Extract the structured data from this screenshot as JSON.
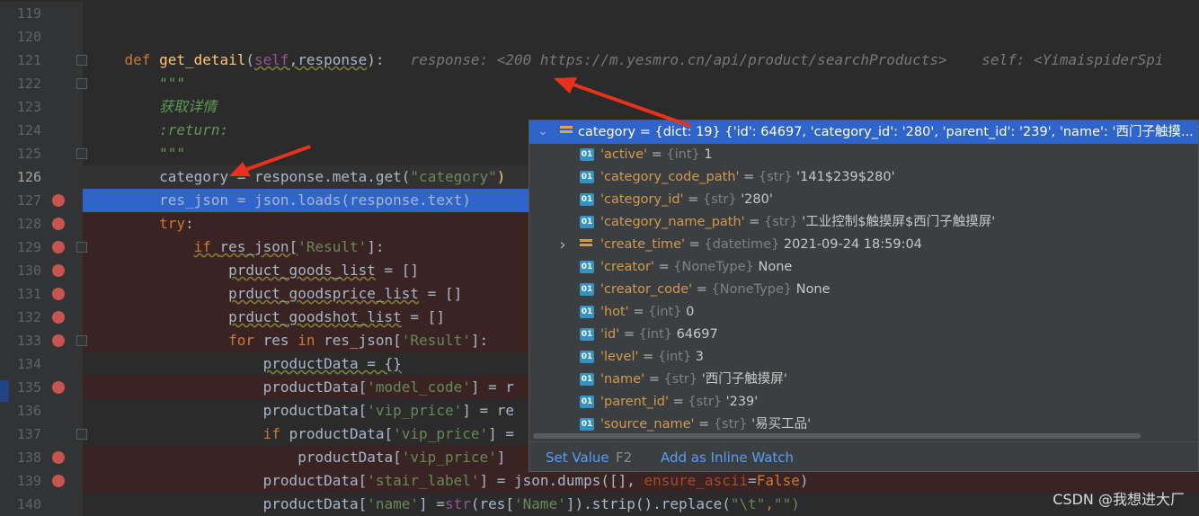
{
  "editor": {
    "lines": [
      {
        "num": "119",
        "segs": []
      },
      {
        "num": "120",
        "segs": []
      },
      {
        "num": "121",
        "fold": true,
        "segs": [
          {
            "t": "    ",
            "c": ""
          },
          {
            "t": "def ",
            "c": "kw"
          },
          {
            "t": "get_detail",
            "c": "fn"
          },
          {
            "t": "(",
            "c": ""
          },
          {
            "t": "self",
            "c": "self sq"
          },
          {
            "t": ",",
            "c": "sq"
          },
          {
            "t": "response",
            "c": "sq"
          },
          {
            "t": "):   ",
            "c": ""
          },
          {
            "t": "response: <200 https://m.yesmro.cn/api/product/searchProducts>    self: <YimaispiderSpi",
            "c": "hint"
          }
        ]
      },
      {
        "num": "122",
        "fold": true,
        "segs": [
          {
            "t": "        ",
            "c": ""
          },
          {
            "t": "\"\"\"",
            "c": "doc"
          }
        ]
      },
      {
        "num": "123",
        "segs": [
          {
            "t": "        ",
            "c": ""
          },
          {
            "t": "获取详情",
            "c": "doc"
          }
        ]
      },
      {
        "num": "124",
        "segs": [
          {
            "t": "        ",
            "c": ""
          },
          {
            "t": ":return:",
            "c": "doc"
          }
        ]
      },
      {
        "num": "125",
        "fold": true,
        "segs": [
          {
            "t": "        ",
            "c": ""
          },
          {
            "t": "\"\"\"",
            "c": "doc"
          }
        ]
      },
      {
        "num": "126",
        "current": true,
        "segs": [
          {
            "t": "        category = response.meta.get(",
            "c": ""
          },
          {
            "t": "\"category\"",
            "c": "str"
          },
          {
            "t": ")",
            "c": "fn"
          }
        ]
      },
      {
        "num": "127",
        "bp": true,
        "selected": true,
        "segs": [
          {
            "t": "        res_json = json.loads(response.text)",
            "c": ""
          }
        ]
      },
      {
        "num": "128",
        "bp": true,
        "segs": [
          {
            "t": "        ",
            "c": ""
          },
          {
            "t": "try",
            "c": "kw"
          },
          {
            "t": ":",
            "c": ""
          }
        ]
      },
      {
        "num": "129",
        "bp": true,
        "fold": true,
        "segs": [
          {
            "t": "            ",
            "c": ""
          },
          {
            "t": "if ",
            "c": "kw sq"
          },
          {
            "t": "res_json[",
            "c": "sq"
          },
          {
            "t": "'Result'",
            "c": "str"
          },
          {
            "t": "]:",
            "c": ""
          }
        ]
      },
      {
        "num": "130",
        "bp": true,
        "segs": [
          {
            "t": "                ",
            "c": ""
          },
          {
            "t": "prduct_goods_list",
            "c": "sq"
          },
          {
            "t": " = []",
            "c": ""
          }
        ]
      },
      {
        "num": "131",
        "bp": true,
        "segs": [
          {
            "t": "                ",
            "c": ""
          },
          {
            "t": "prduct_goodsprice_list",
            "c": "sq"
          },
          {
            "t": " = []",
            "c": ""
          }
        ]
      },
      {
        "num": "132",
        "bp": true,
        "segs": [
          {
            "t": "                ",
            "c": ""
          },
          {
            "t": "prduct_goodshot_list",
            "c": "sq"
          },
          {
            "t": " = []",
            "c": ""
          }
        ]
      },
      {
        "num": "133",
        "bp": true,
        "fold": true,
        "segs": [
          {
            "t": "                ",
            "c": ""
          },
          {
            "t": "for ",
            "c": "kw"
          },
          {
            "t": "res ",
            "c": ""
          },
          {
            "t": "in ",
            "c": "kw"
          },
          {
            "t": "res_json[",
            "c": ""
          },
          {
            "t": "'Result'",
            "c": "str"
          },
          {
            "t": "]:",
            "c": ""
          }
        ]
      },
      {
        "num": "134",
        "segs": [
          {
            "t": "                    ",
            "c": ""
          },
          {
            "t": "productData = {}",
            "c": "sq"
          }
        ]
      },
      {
        "num": "135",
        "bp": true,
        "segs": [
          {
            "t": "                    productData[",
            "c": ""
          },
          {
            "t": "'model_code'",
            "c": "str"
          },
          {
            "t": "] = r",
            "c": ""
          }
        ]
      },
      {
        "num": "136",
        "segs": [
          {
            "t": "                    productData[",
            "c": ""
          },
          {
            "t": "'vip_price'",
            "c": "str"
          },
          {
            "t": "] = re",
            "c": ""
          }
        ]
      },
      {
        "num": "137",
        "fold": true,
        "segs": [
          {
            "t": "                    ",
            "c": ""
          },
          {
            "t": "if ",
            "c": "kw"
          },
          {
            "t": "productData[",
            "c": ""
          },
          {
            "t": "'vip_price'",
            "c": "str"
          },
          {
            "t": "] =",
            "c": ""
          }
        ]
      },
      {
        "num": "138",
        "bp": true,
        "segs": [
          {
            "t": "                        productData[",
            "c": ""
          },
          {
            "t": "'vip_price'",
            "c": "str"
          },
          {
            "t": "]",
            "c": ""
          }
        ]
      },
      {
        "num": "139",
        "bp": true,
        "segs": [
          {
            "t": "                    productData[",
            "c": ""
          },
          {
            "t": "'stair_label'",
            "c": "str"
          },
          {
            "t": "] = json.dumps([], ",
            "c": ""
          },
          {
            "t": "ensure_ascii",
            "c": "param"
          },
          {
            "t": "=",
            "c": ""
          },
          {
            "t": "False",
            "c": "kw"
          },
          {
            "t": ")",
            "c": ""
          }
        ]
      },
      {
        "num": "140",
        "segs": [
          {
            "t": "                    productData[",
            "c": ""
          },
          {
            "t": "'name'",
            "c": "str"
          },
          {
            "t": "] =",
            "c": ""
          },
          {
            "t": "str",
            "c": "self"
          },
          {
            "t": "(res[",
            "c": ""
          },
          {
            "t": "'Name'",
            "c": "str"
          },
          {
            "t": "]).strip().replace(",
            "c": ""
          },
          {
            "t": "\"\\t\"",
            "c": "str"
          },
          {
            "t": ",",
            "c": "kw"
          },
          {
            "t": "\"\")",
            "c": "str"
          }
        ]
      }
    ]
  },
  "popup": {
    "header": {
      "key": "category",
      "eq": " = ",
      "type": "{dict: 19} ",
      "val": "{'id': 64697, 'category_id': '280', 'parent_id': '239', 'name': '西门子触摸... View"
    },
    "rows": [
      {
        "key": "'active'",
        "type": "{int}",
        "val": "1",
        "kind": "01"
      },
      {
        "key": "'category_code_path'",
        "type": "{str}",
        "val": "'141$239$280'",
        "kind": "01"
      },
      {
        "key": "'category_id'",
        "type": "{str}",
        "val": "'280'",
        "kind": "01"
      },
      {
        "key": "'category_name_path'",
        "type": "{str}",
        "val": "'工业控制$触摸屏$西门子触摸屏'",
        "kind": "01"
      },
      {
        "key": "'create_time'",
        "type": "{datetime}",
        "val": "2021-09-24 18:59:04",
        "kind": "dict",
        "expand": true
      },
      {
        "key": "'creator'",
        "type": "{NoneType}",
        "val": "None",
        "kind": "01"
      },
      {
        "key": "'creator_code'",
        "type": "{NoneType}",
        "val": "None",
        "kind": "01"
      },
      {
        "key": "'hot'",
        "type": "{int}",
        "val": "0",
        "kind": "01"
      },
      {
        "key": "'id'",
        "type": "{int}",
        "val": "64697",
        "kind": "01"
      },
      {
        "key": "'level'",
        "type": "{int}",
        "val": "3",
        "kind": "01"
      },
      {
        "key": "'name'",
        "type": "{str}",
        "val": "'西门子触摸屏'",
        "kind": "01"
      },
      {
        "key": "'parent_id'",
        "type": "{str}",
        "val": "'239'",
        "kind": "01"
      },
      {
        "key": "'source_name'",
        "type": "{str}",
        "val": "'易买工品'",
        "kind": "01"
      }
    ],
    "footer": {
      "set_value": "Set Value",
      "set_value_key": "F2",
      "add_watch": "Add as Inline Watch"
    }
  },
  "watermark": "CSDN @我想进大厂",
  "colors": {
    "arrow": "#e8321e",
    "selection": "#2f65ca",
    "breakpoint": "#c75450"
  }
}
